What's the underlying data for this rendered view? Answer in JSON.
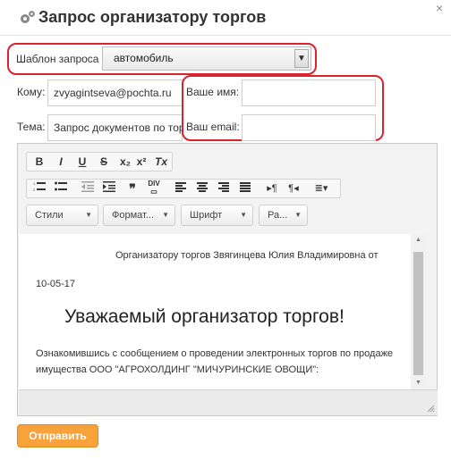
{
  "dialog": {
    "title": "Запрос организатору торгов",
    "close_icon": "×"
  },
  "form": {
    "template_label": "Шаблон запроса",
    "template_value": "автомобиль",
    "to_label": "Кому:",
    "to_value": "zvyagintseva@pochta.ru",
    "subject_label": "Тема:",
    "subject_value": "Запрос документов по торгам",
    "name_label": "Ваше имя:",
    "name_value": "",
    "email_label": "Ваш email:",
    "email_value": ""
  },
  "toolbar": {
    "row1": [
      "B",
      "I",
      "U",
      "S",
      "x₂",
      "x²",
      "Tx"
    ],
    "row2": [
      "list-numbered",
      "list-bulleted",
      "outdent",
      "indent",
      "blockquote",
      "div",
      "align-left",
      "align-center",
      "align-right",
      "align-justify",
      "ltr",
      "rtl",
      "language"
    ],
    "combos": [
      "Стили",
      "Формат...",
      "Шрифт",
      "Ра..."
    ]
  },
  "content": {
    "line1": "Организатору торгов Звягинцева Юлия Владимировна от",
    "date": "10-05-17",
    "heading": "Уважаемый организатор торгов!",
    "para": "Ознакомившись с сообщением о проведении электронных торгов по продаже имущества ООО \"АГРОХОЛДИНГ \"МИЧУРИНСКИЕ ОВОЩИ\":"
  },
  "send_label": "Отправить",
  "colors": {
    "highlight": "#d9232d",
    "send_button": "#f7a23a"
  }
}
